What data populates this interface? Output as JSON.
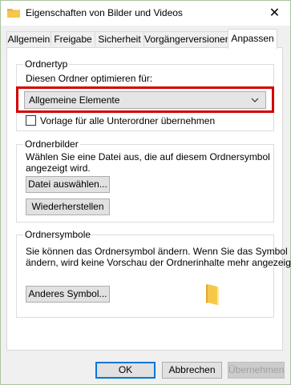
{
  "window": {
    "title": "Eigenschaften von Bilder und Videos",
    "close_glyph": "✕"
  },
  "tabs": [
    {
      "label": "Allgemein"
    },
    {
      "label": "Freigabe"
    },
    {
      "label": "Sicherheit"
    },
    {
      "label": "Vorgängerversionen"
    },
    {
      "label": "Anpassen",
      "active": true
    }
  ],
  "ordnertyp": {
    "group_title": "Ordnertyp",
    "label": "Diesen Ordner optimieren für:",
    "combo_value": "Allgemeine Elemente",
    "checkbox_label": "Vorlage für alle Unterordner übernehmen",
    "checkbox_checked": false
  },
  "ordnerbilder": {
    "group_title": "Ordnerbilder",
    "description_line1": "Wählen Sie eine Datei aus, die auf diesem Ordnersymbol",
    "description_line2": "angezeigt wird.",
    "choose_button": "Datei auswählen...",
    "restore_button": "Wiederherstellen"
  },
  "ordnersymbole": {
    "group_title": "Ordnersymbole",
    "description_line1": "Sie können das Ordnersymbol ändern. Wenn Sie das Symbol",
    "description_line2": "ändern, wird keine Vorschau der Ordnerinhalte mehr angezeigt.",
    "change_button": "Anderes Symbol..."
  },
  "footer": {
    "ok": "OK",
    "cancel": "Abbrechen",
    "apply": "Übernehmen"
  },
  "colors": {
    "highlight": "#d40000",
    "folder": "#f5c84a"
  },
  "icons": {
    "title": "folder-icon",
    "close": "close-icon",
    "combo": "chevron-down-icon",
    "preview": "folder-icon"
  }
}
